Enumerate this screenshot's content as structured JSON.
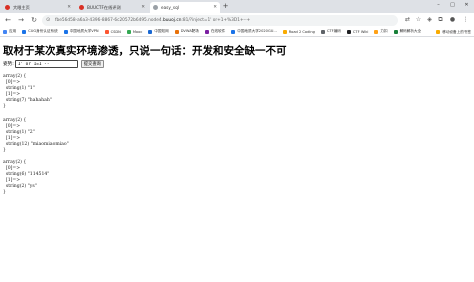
{
  "browser": {
    "tabs": [
      {
        "title": "大眼主页",
        "favicon_color": "#d93025"
      },
      {
        "title": "BUUCTF在线评测",
        "favicon_color": "#d93025"
      },
      {
        "title": "easy_sql",
        "favicon_color": "#9aa0a6"
      }
    ],
    "address": {
      "prefix": "fbe56d58-a6a3-4396-8867-6c20572b6495.node4.",
      "host": "buuoj.cn",
      "path": ":81/?inject=1' or+1+%3D1+--+"
    },
    "bookmarks": [
      {
        "label": "应用",
        "color": "#4285f4"
      },
      {
        "label": "CUG身份认证系统",
        "color": "#1a73e8"
      },
      {
        "label": "中国地质大学VPN",
        "color": "#1a73e8"
      },
      {
        "label": "CSDN",
        "color": "#fc5531"
      },
      {
        "label": "Mooc",
        "color": "#34a853"
      },
      {
        "label": "中国知网",
        "color": "#1967d2"
      },
      {
        "label": "DVWA靶场",
        "color": "#e8710a"
      },
      {
        "label": "在线软件",
        "color": "#7b1fa2"
      },
      {
        "label": "中国地质大学2020GU...",
        "color": "#1a73e8"
      },
      {
        "label": "Road 2 Coding",
        "color": "#f9ab00"
      },
      {
        "label": "CTF编码",
        "color": "#5f6368"
      },
      {
        "label": "CTF Wiki",
        "color": "#202124"
      },
      {
        "label": "力扣",
        "color": "#ffa116"
      },
      {
        "label": "解码解析大全",
        "color": "#188038"
      }
    ],
    "bookmarks_other": "移动设备上的书签"
  },
  "page": {
    "title": "取材于某次真实环境渗透，只说一句话：开发和安全缺一不可",
    "form": {
      "label": "姿势:",
      "input_value": "1' or 1=1 -- ",
      "submit_label": "提交查询"
    },
    "results": [
      "array(2) {\n  [0]=>\n  string(1) \"1\"\n  [1]=>\n  string(7) \"hahahah\"\n}",
      "array(2) {\n  [0]=>\n  string(1) \"2\"\n  [1]=>\n  string(12) \"miaomiaomiao\"\n}",
      "array(2) {\n  [0]=>\n  string(6) \"114514\"\n  [1]=>\n  string(2) \"ys\"\n}"
    ]
  }
}
